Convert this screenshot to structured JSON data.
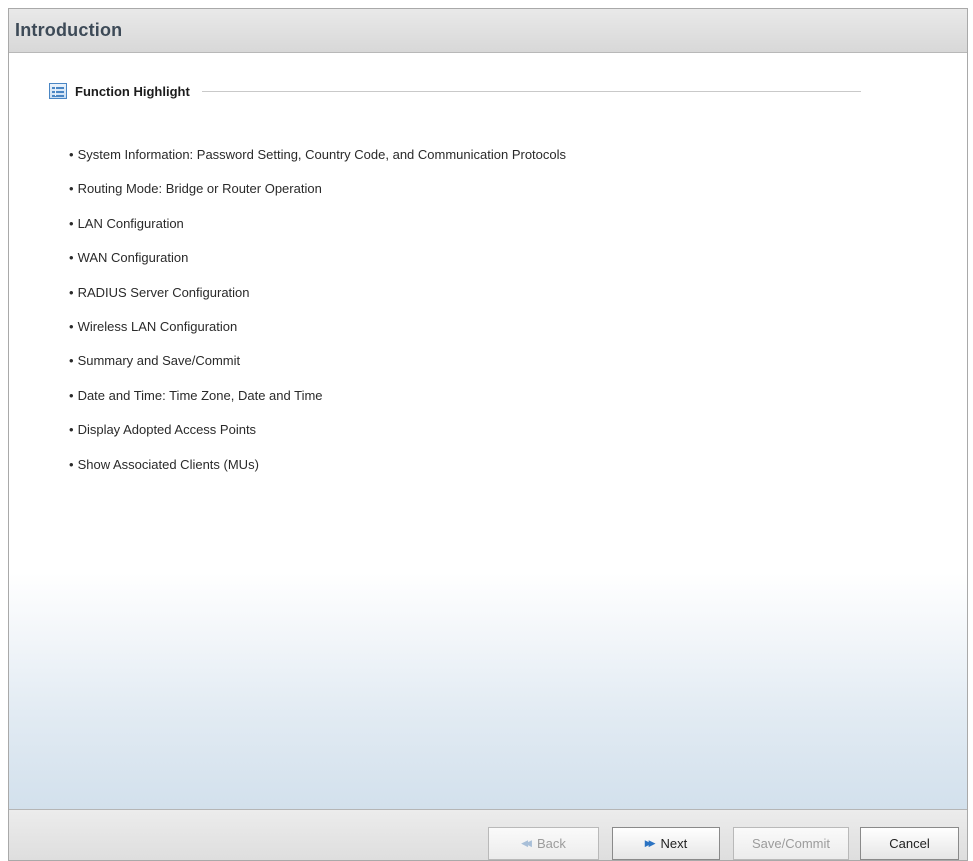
{
  "window": {
    "title": "Introduction"
  },
  "section": {
    "title": "Function Highlight",
    "icon": "list-icon"
  },
  "features": [
    "System Information: Password Setting, Country Code, and Communication Protocols",
    "Routing Mode: Bridge or Router Operation",
    "LAN Configuration",
    "WAN Configuration",
    "RADIUS Server Configuration",
    "Wireless LAN Configuration",
    "Summary and Save/Commit",
    "Date and Time: Time Zone, Date and Time",
    "Display Adopted Access Points",
    "Show Associated Clients (MUs)"
  ],
  "footer": {
    "back_label": "Back",
    "back_icon": "rewind-icon",
    "back_enabled": false,
    "next_label": "Next",
    "next_icon": "fast-forward-icon",
    "next_enabled": true,
    "save_label": "Save/Commit",
    "save_enabled": false,
    "cancel_label": "Cancel",
    "cancel_enabled": true
  },
  "colors": {
    "title_text": "#3d4a57",
    "icon_accent": "#4a86c4",
    "next_icon": "#2b73c2",
    "disabled_text": "#9c9c9c"
  }
}
